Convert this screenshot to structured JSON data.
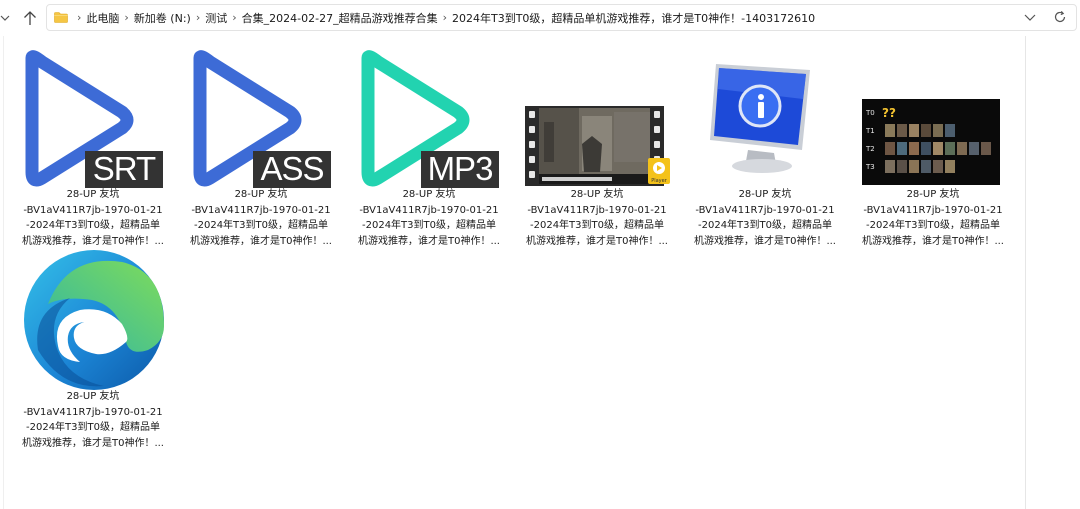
{
  "address_bar": {
    "breadcrumbs": [
      "此电脑",
      "新加卷 (N:)",
      "测试",
      "合集_2024-02-27_超精品游戏推荐合集",
      "2024年T3到T0级，超精品单机游戏推荐，谁才是T0神作！-1403172610"
    ]
  },
  "files": [
    {
      "type": "srt",
      "badge": "SRT",
      "lines": [
        "28-UP 友坑",
        "-BV1aV411R7jb-1970-01-21",
        "-2024年T3到T0级，超精品单",
        "机游戏推荐，谁才是T0神作！..."
      ]
    },
    {
      "type": "ass",
      "badge": "ASS",
      "lines": [
        "28-UP 友坑",
        "-BV1aV411R7jb-1970-01-21",
        "-2024年T3到T0级，超精品单",
        "机游戏推荐，谁才是T0神作！..."
      ]
    },
    {
      "type": "mp3",
      "badge": "MP3",
      "lines": [
        "28-UP 友坑",
        "-BV1aV411R7jb-1970-01-21",
        "-2024年T3到T0级，超精品单",
        "机游戏推荐，谁才是T0神作！..."
      ]
    },
    {
      "type": "video",
      "overlay": "Player",
      "lines": [
        "28-UP 友坑",
        "-BV1aV411R7jb-1970-01-21",
        "-2024年T3到T0级，超精品单",
        "机游戏推荐，谁才是T0神作！..."
      ]
    },
    {
      "type": "info",
      "lines": [
        "28-UP 友坑",
        "-BV1aV411R7jb-1970-01-21",
        "-2024年T3到T0级，超精品单",
        "机游戏推荐，谁才是T0神作！..."
      ]
    },
    {
      "type": "tier-image",
      "tiers": [
        "T0",
        "T1",
        "T2",
        "T3"
      ],
      "lines": [
        "28-UP 友坑",
        "-BV1aV411R7jb-1970-01-21",
        "-2024年T3到T0级，超精品单",
        "机游戏推荐，谁才是T0神作！..."
      ]
    },
    {
      "type": "edge-html",
      "lines": [
        "28-UP 友坑",
        "-BV1aV411R7jb-1970-01-21",
        "-2024年T3到T0级，超精品单",
        "机游戏推荐，谁才是T0神作！..."
      ]
    }
  ],
  "colors": {
    "play_blue": "#3d6bd6",
    "play_teal": "#22d3b0",
    "badge": "#333333"
  }
}
